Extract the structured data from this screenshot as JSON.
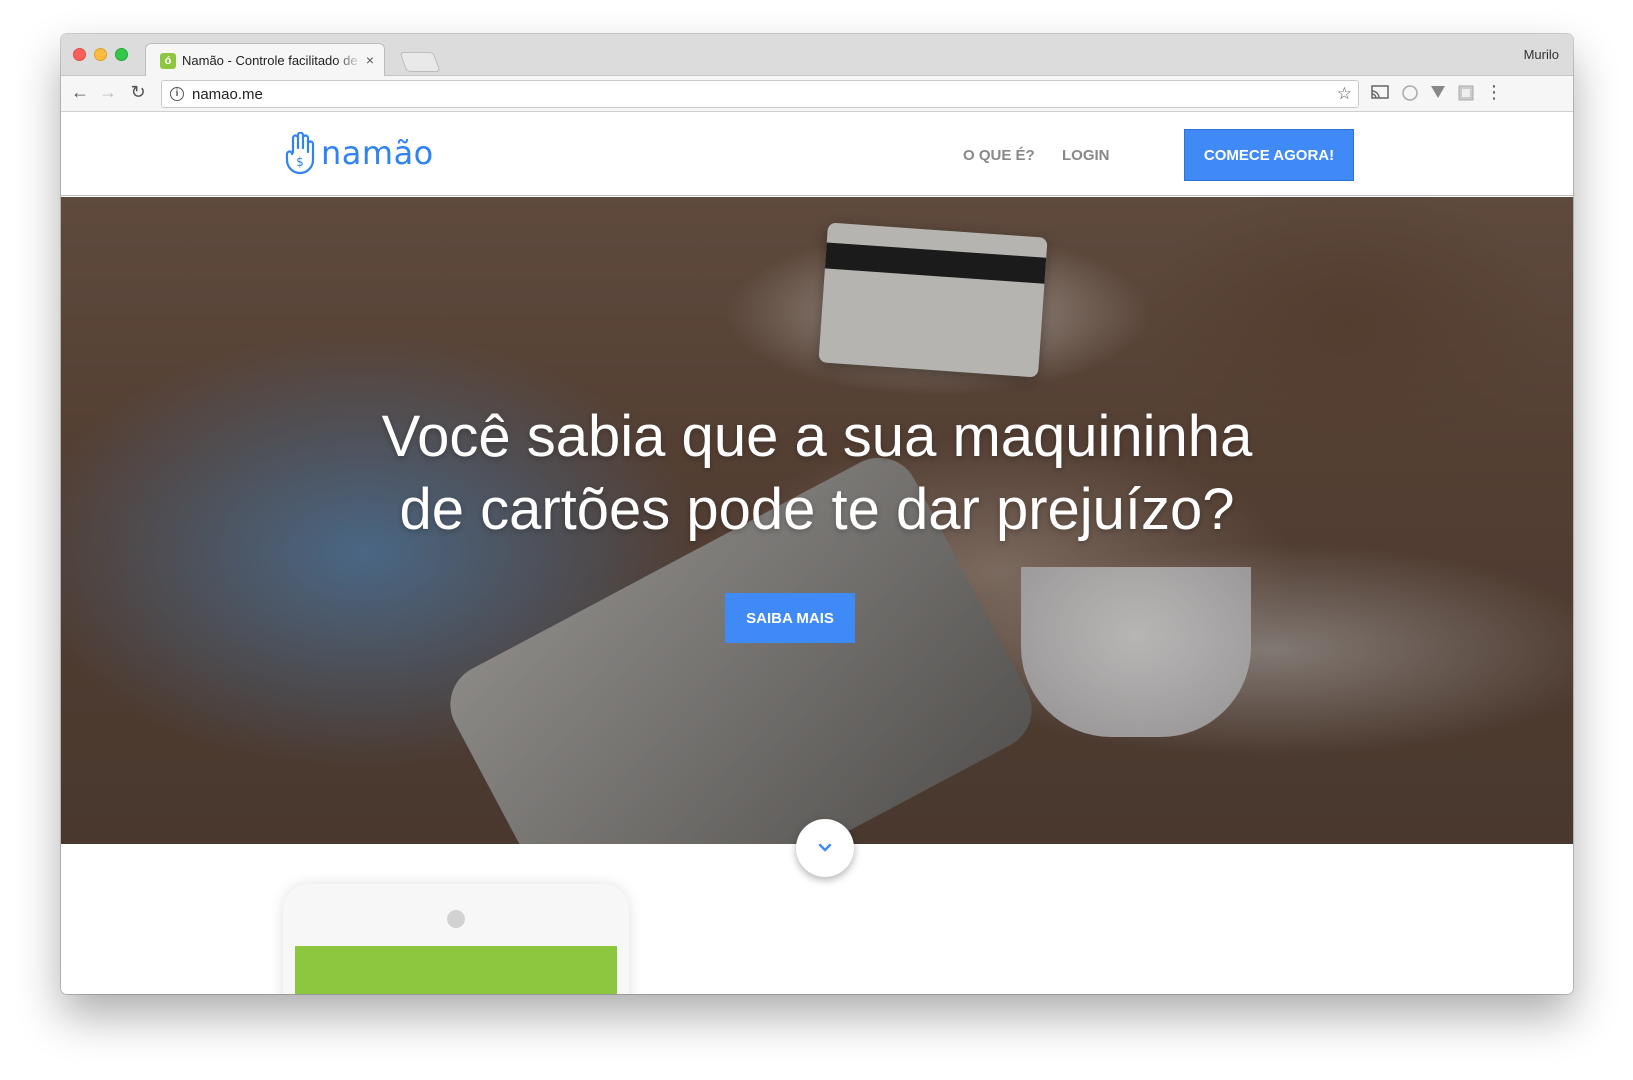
{
  "browser": {
    "tab_title": "Namão - Controle facilitado de",
    "tab_close": "×",
    "profile_name": "Murilo",
    "url": "namao.me",
    "back": "←",
    "forward": "→",
    "reload": "↻",
    "star": "☆",
    "menu": "⋮"
  },
  "site": {
    "logo_text": "namão",
    "nav": {
      "what_is": "O QUE É?",
      "login": "LOGIN",
      "cta": "COMECE AGORA!"
    },
    "hero": {
      "title_line1": "Você sabia que a sua maquininha",
      "title_line2": "de cartões pode te dar prejuízo?",
      "button": "SAIBA MAIS",
      "scroll_icon": "⌄"
    },
    "colors": {
      "accent": "#3f8af7",
      "logo": "#2f83f2",
      "phone_screen": "#8dc63f"
    }
  }
}
